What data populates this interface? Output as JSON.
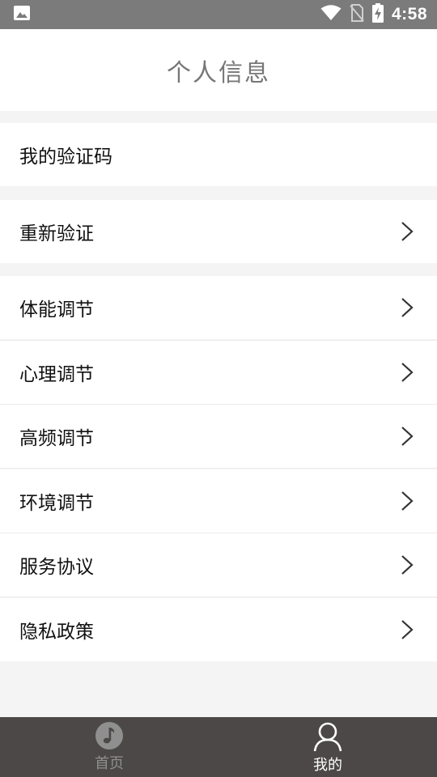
{
  "status_bar": {
    "time": "4:58",
    "icons": [
      "image-icon",
      "wifi-icon",
      "no-sim-icon",
      "battery-charging-icon"
    ]
  },
  "header": {
    "title": "个人信息"
  },
  "sections": {
    "verify_code": {
      "label": "我的验证码"
    },
    "reverify": {
      "label": "重新验证"
    },
    "items": [
      {
        "label": "体能调节"
      },
      {
        "label": "心理调节"
      },
      {
        "label": "高频调节"
      },
      {
        "label": "环境调节"
      },
      {
        "label": "服务协议"
      },
      {
        "label": "隐私政策"
      }
    ]
  },
  "tab_bar": {
    "tabs": [
      {
        "label": "首页",
        "icon": "music-note-icon",
        "active": false
      },
      {
        "label": "我的",
        "icon": "person-icon",
        "active": true
      }
    ]
  },
  "colors": {
    "status_bar": "#7b7b7b",
    "tab_bar": "#4c4848",
    "background": "#f4f4f4",
    "title_text": "#777777",
    "tab_inactive": "#8f8f8f",
    "tab_active": "#ffffff"
  }
}
